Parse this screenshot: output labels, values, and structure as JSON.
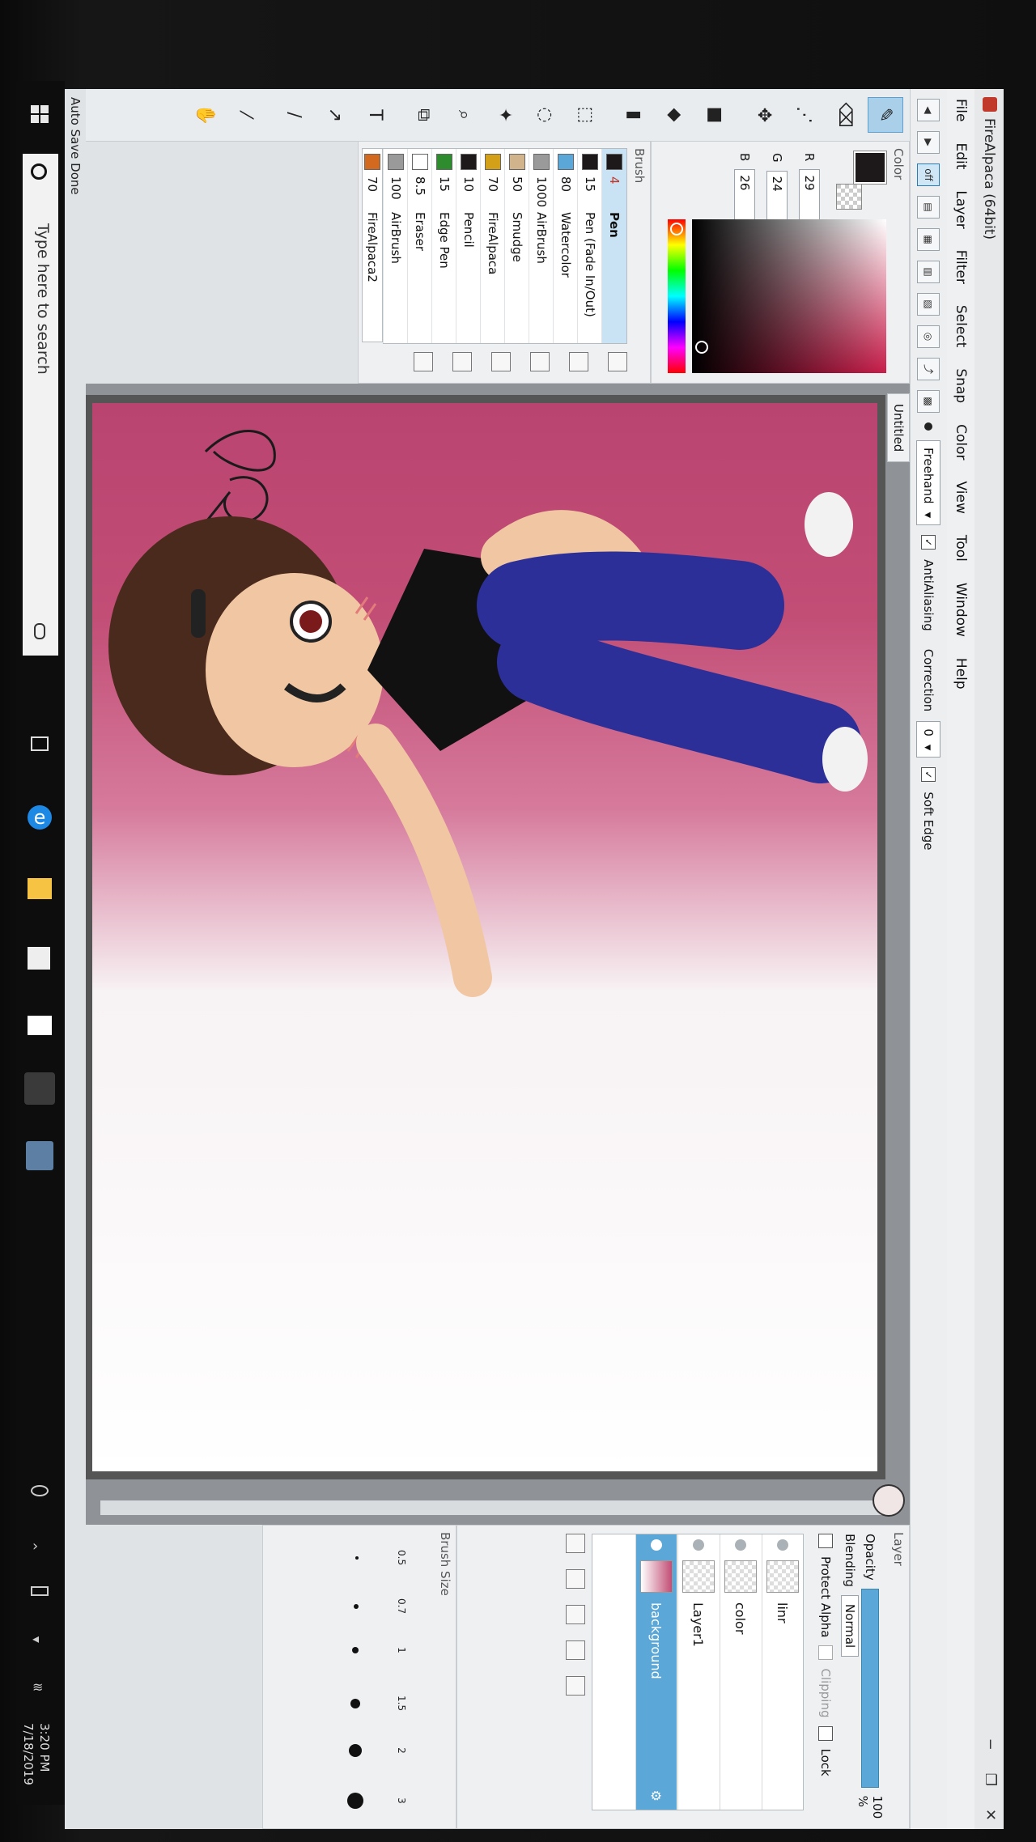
{
  "window": {
    "title": "FireAlpaca (64bit)",
    "controls": [
      "−",
      "❐",
      "✕"
    ]
  },
  "menu": [
    "File",
    "Edit",
    "Layer",
    "Filter",
    "Select",
    "Snap",
    "Color",
    "View",
    "Tool",
    "Window",
    "Help"
  ],
  "toolbar": {
    "mode_label": "Freehand",
    "antialiasing_label": "AntiAliasing",
    "correction_label": "Correction",
    "correction_value": "0",
    "soft_edge_label": "Soft Edge",
    "off_label": "off"
  },
  "color_panel": {
    "title": "Color",
    "r_label": "R",
    "r_value": "29",
    "g_label": "G",
    "g_value": "24",
    "b_label": "B",
    "b_value": "26",
    "current_color": "#1d181a"
  },
  "brush_panel": {
    "title": "Brush",
    "items": [
      {
        "size": "4",
        "name": "Pen",
        "color": "#1d181a"
      },
      {
        "size": "15",
        "name": "Pen (Fade In/Out)",
        "color": "#1d181a"
      },
      {
        "size": "80",
        "name": "Watercolor",
        "color": "#5aa7d8"
      },
      {
        "size": "1000",
        "name": "AirBrush",
        "color": "#9a9a9a"
      },
      {
        "size": "50",
        "name": "Smudge",
        "color": "#d2b48c"
      },
      {
        "size": "70",
        "name": "FireAlpaca",
        "color": "#d4a017"
      },
      {
        "size": "10",
        "name": "Pencil",
        "color": "#1d181a"
      },
      {
        "size": "15",
        "name": "Edge Pen",
        "color": "#2e8b2e"
      },
      {
        "size": "8.5",
        "name": "Eraser",
        "color": "#ffffff"
      },
      {
        "size": "100",
        "name": "AirBrush",
        "color": "#9a9a9a"
      },
      {
        "size": "70",
        "name": "FireAlpaca2",
        "color": "#d2691e"
      }
    ]
  },
  "canvas": {
    "tab_label": "Untitled",
    "status": "Auto Save Done"
  },
  "layer_panel": {
    "title": "Layer",
    "opacity_label": "Opacity",
    "opacity_value": "100 %",
    "blending_label": "Blending",
    "blending_value": "Normal",
    "protect_alpha_label": "Protect Alpha",
    "clipping_label": "Clipping",
    "lock_label": "Lock",
    "layers": [
      {
        "name": "linr",
        "selected": false
      },
      {
        "name": "color",
        "selected": false
      },
      {
        "name": "Layer1",
        "selected": false
      },
      {
        "name": "background",
        "selected": true
      }
    ]
  },
  "brush_size_panel": {
    "title": "Brush Size",
    "sizes": [
      "0.5",
      "0.7",
      "1",
      "1.5",
      "2",
      "3"
    ]
  },
  "taskbar": {
    "search_placeholder": "Type here to search",
    "time": "3:20 PM",
    "date": "7/18/2019"
  }
}
